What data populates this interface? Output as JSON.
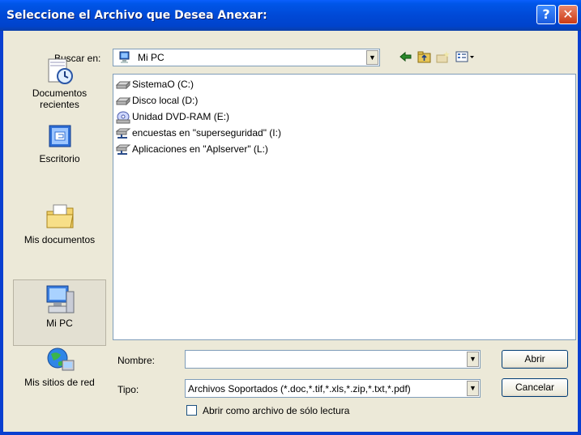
{
  "title": "Seleccione el Archivo que Desea Anexar:",
  "titlebar": {
    "help": "?",
    "close": "✕"
  },
  "lookin": {
    "label": "Buscar en:",
    "value": "Mi PC"
  },
  "places": [
    {
      "line1": "Documentos",
      "line2": "recientes"
    },
    {
      "line1": "Escritorio"
    },
    {
      "line1": "Mis documentos"
    },
    {
      "line1": "Mi PC"
    },
    {
      "line1": "Mis sitios de red"
    }
  ],
  "files": [
    {
      "name": "SistemaO (C:)",
      "icon": "drive-icon"
    },
    {
      "name": "Disco local (D:)",
      "icon": "drive-icon"
    },
    {
      "name": "Unidad DVD-RAM (E:)",
      "icon": "dvd-icon"
    },
    {
      "name": "encuestas en \"superseguridad\" (I:)",
      "icon": "network-drive-icon"
    },
    {
      "name": "Aplicaciones en \"Aplserver\" (L:)",
      "icon": "network-drive-icon"
    }
  ],
  "filename": {
    "label": "Nombre:",
    "value": ""
  },
  "filetype": {
    "label": "Tipo:",
    "value": "Archivos Soportados (*.doc,*.tif,*.xls,*.zip,*.txt,*.pdf)"
  },
  "buttons": {
    "open": "Abrir",
    "cancel": "Cancelar"
  },
  "readonly": {
    "label": "Abrir como archivo de sólo lectura",
    "checked": false
  },
  "colors": {
    "titlebar": "#0049d6",
    "dialog": "#ece9d8",
    "border": "#7f9db9"
  }
}
